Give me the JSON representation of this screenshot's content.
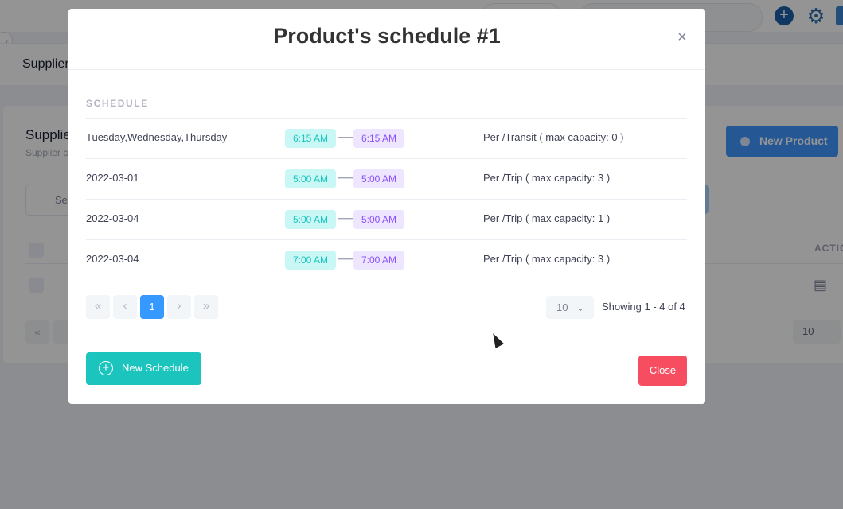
{
  "background": {
    "subheader_title": "Supplier",
    "card_title": "Supplie",
    "card_subtitle": "Supplier c",
    "new_product_label": "New Product",
    "search_fragment": "Se",
    "actions_header": "ACTIO",
    "page_size": "10"
  },
  "modal": {
    "title": "Product's schedule #1",
    "close_symbol": "×",
    "section_label": "SCHEDULE",
    "rows": [
      {
        "days": "Tuesday,Wednesday,Thursday",
        "from": "6:15 AM",
        "to": "6:15 AM",
        "capacity": "Per /Transit ( max capacity: 0 )"
      },
      {
        "days": "2022-03-01",
        "from": "5:00 AM",
        "to": "5:00 AM",
        "capacity": "Per /Trip ( max capacity: 3 )"
      },
      {
        "days": "2022-03-04",
        "from": "5:00 AM",
        "to": "5:00 AM",
        "capacity": "Per /Trip ( max capacity: 1 )"
      },
      {
        "days": "2022-03-04",
        "from": "7:00 AM",
        "to": "7:00 AM",
        "capacity": "Per /Trip ( max capacity: 3 )"
      }
    ],
    "arrow_symbol": "⟶",
    "pagination": {
      "first": "«",
      "prev": "‹",
      "current": "1",
      "next": "›",
      "last": "»",
      "page_size": "10",
      "showing": "Showing 1 - 4 of 4"
    },
    "new_schedule_label": "New Schedule",
    "close_label": "Close"
  },
  "colors": {
    "primary": "#3699ff",
    "teal": "#1bc5bd",
    "danger": "#f64e60",
    "purple": "#8950fc"
  }
}
